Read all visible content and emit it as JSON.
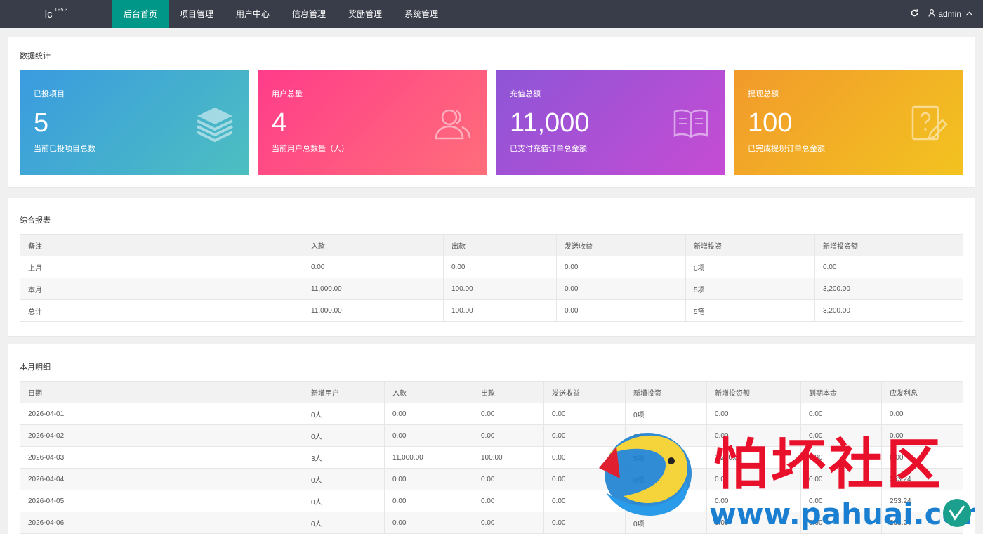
{
  "app": {
    "logo": "lc",
    "logo_sup": "TP5.3"
  },
  "nav": [
    {
      "label": "后台首页",
      "active": true
    },
    {
      "label": "项目管理",
      "active": false
    },
    {
      "label": "用户中心",
      "active": false
    },
    {
      "label": "信息管理",
      "active": false
    },
    {
      "label": "奖励管理",
      "active": false
    },
    {
      "label": "系统管理",
      "active": false
    }
  ],
  "topright": {
    "refresh_icon": "refresh-icon",
    "user": "admin",
    "user_icon": "user-icon",
    "caret": "chevron-up-icon"
  },
  "stats_section": {
    "title": "数据统计",
    "cards": [
      {
        "label": "已投项目",
        "value": "5",
        "desc": "当前已投项目总数",
        "icon": "layers-icon"
      },
      {
        "label": "用户总量",
        "value": "4",
        "desc": "当前用户总数量（人）",
        "icon": "users-icon"
      },
      {
        "label": "充值总额",
        "value": "11,000",
        "desc": "已支付充值订单总金额",
        "icon": "book-icon"
      },
      {
        "label": "提现总额",
        "value": "100",
        "desc": "已完成提现订单总金额",
        "icon": "question-edit-icon"
      }
    ]
  },
  "report": {
    "title": "综合报表",
    "headers": [
      "备注",
      "入款",
      "出款",
      "发送收益",
      "新增投资",
      "新增投资额"
    ],
    "rows": [
      [
        "上月",
        "0.00",
        "0.00",
        "0.00",
        "0项",
        "0.00"
      ],
      [
        "本月",
        "11,000.00",
        "100.00",
        "0.00",
        "5项",
        "3,200.00"
      ],
      [
        "总计",
        "11,000.00",
        "100.00",
        "0.00",
        "5笔",
        "3,200.00"
      ]
    ]
  },
  "monthly": {
    "title": "本月明细",
    "headers": [
      "日期",
      "新增用户",
      "入款",
      "出款",
      "发送收益",
      "新增投资",
      "新增投资额",
      "到期本金",
      "应发利息"
    ],
    "rows": [
      [
        "2026-04-01",
        "0人",
        "0.00",
        "0.00",
        "0.00",
        "0项",
        "0.00",
        "0.00",
        "0.00"
      ],
      [
        "2026-04-02",
        "0人",
        "0.00",
        "0.00",
        "0.00",
        "0项",
        "0.00",
        "0.00",
        "0.00"
      ],
      [
        "2026-04-03",
        "3人",
        "11,000.00",
        "100.00",
        "0.00",
        "5项",
        "3,200.00",
        "0.00",
        "0.00"
      ],
      [
        "2026-04-04",
        "0人",
        "0.00",
        "0.00",
        "0.00",
        "0项",
        "0.00",
        "0.00",
        "253.24"
      ],
      [
        "2026-04-05",
        "0人",
        "0.00",
        "0.00",
        "0.00",
        "0项",
        "0.00",
        "0.00",
        "253.24"
      ],
      [
        "2026-04-06",
        "0人",
        "0.00",
        "0.00",
        "0.00",
        "0项",
        "0.00",
        "0.00",
        "253.24"
      ]
    ]
  },
  "watermark": {
    "text": "怕坏社区",
    "url": "www.pahuai.com"
  }
}
